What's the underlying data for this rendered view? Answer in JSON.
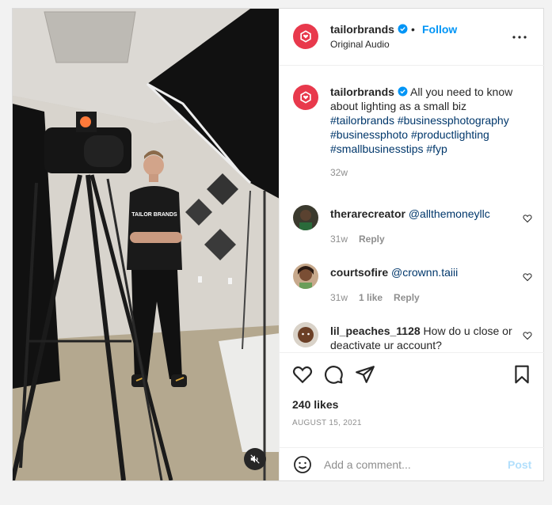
{
  "media": {
    "shirt_text": "TAILOR BRANDS",
    "mute_icon": "speaker-muted-icon"
  },
  "header": {
    "username": "tailorbrands",
    "separator": "•",
    "follow_label": "Follow",
    "audio": "Original Audio",
    "verified_icon": "verified-badge-icon",
    "more_icon": "more-options-icon"
  },
  "caption": {
    "username": "tailorbrands",
    "text": "All you need to know about lighting as a small biz",
    "hashtags": "#tailorbrands #businessphotography #businessphoto #productlighting #smallbusinesstips #fyp",
    "time": "32w"
  },
  "comments": [
    {
      "username": "therarecreator",
      "text": "@allthemoneyllc",
      "time": "31w",
      "likes": "",
      "reply": "Reply"
    },
    {
      "username": "courtsofire",
      "text": "@crownn.taiii",
      "time": "31w",
      "likes": "1 like",
      "reply": "Reply"
    },
    {
      "username": "lil_peaches_1128",
      "text": "How do u close or deactivate ur account?",
      "time": "",
      "likes": "",
      "reply": ""
    }
  ],
  "actions": {
    "likes": "240 likes",
    "date": "AUGUST 15, 2021",
    "icons": [
      "heart-icon",
      "comment-icon",
      "share-icon",
      "bookmark-icon"
    ]
  },
  "add_comment": {
    "placeholder": "Add a comment...",
    "post_label": "Post",
    "emoji_icon": "emoji-icon"
  },
  "colors": {
    "brand": "#e8394c",
    "link": "#0095f6",
    "hashtag": "#00376b",
    "muted": "#8e8e8e",
    "post_disabled": "#b2dffc"
  }
}
